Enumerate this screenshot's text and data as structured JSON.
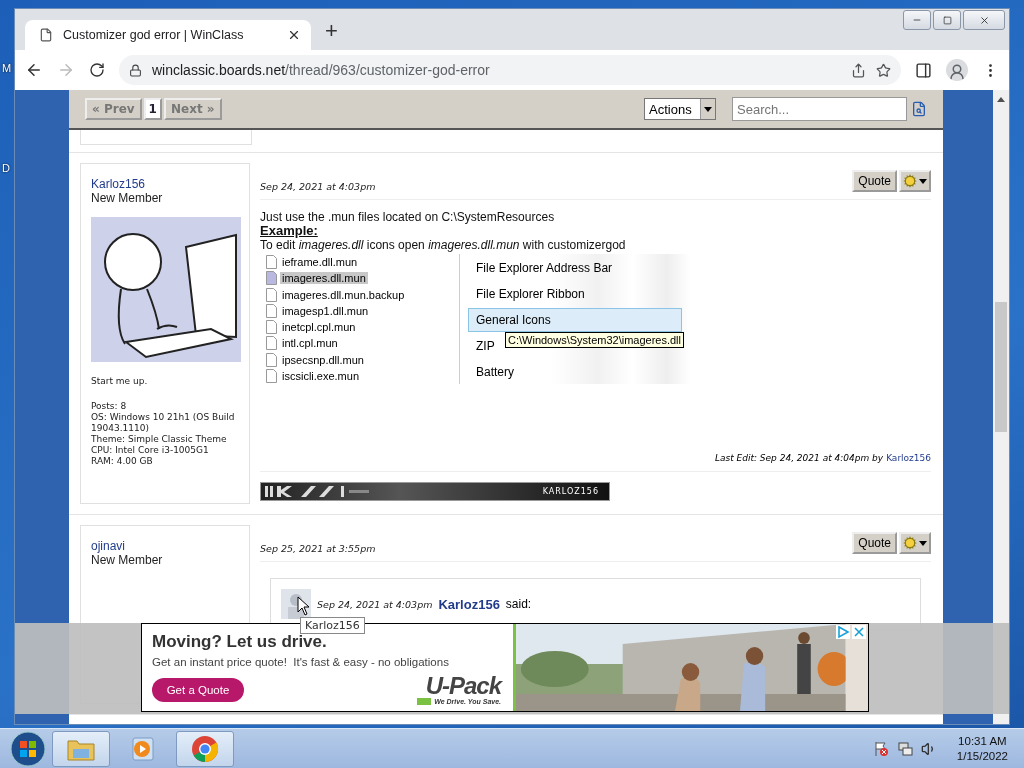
{
  "desktop": {
    "icon_labels": [
      "M",
      "D"
    ]
  },
  "browser": {
    "tab": {
      "title": "Customizer god error | WinClass",
      "selected": true
    },
    "new_tab": "+",
    "address": {
      "host": "winclassic.boards.net",
      "path": "/thread/963/customizer-god-error"
    }
  },
  "forum": {
    "pager": {
      "prev": "« Prev",
      "pages": [
        {
          "label": "1",
          "selected": true
        }
      ],
      "next": "Next »"
    },
    "actions": "Actions",
    "search": {
      "placeholder": "Search..."
    },
    "posts": [
      {
        "author": "Karloz156",
        "rank": "New Member",
        "personal_text": "Start me up.",
        "stats": [
          "Posts: 8",
          "OS: Windows 10 21h1 (OS Build 19043.1110)",
          "Theme: Simple Classic Theme",
          "CPU: Intel Core i3-1005G1",
          "RAM: 4.00 GB"
        ],
        "date": "Sep 24, 2021 at 4:03pm",
        "quote_button": "Quote",
        "body": [
          {
            "kind": "text",
            "text": "Just use the .mun files located on C:\\SystemResources"
          },
          {
            "kind": "heading",
            "text": "Example:"
          },
          {
            "kind": "text",
            "text": "To edit *imageres.dll* icons open *imageres.dll.mun* with customizergod"
          }
        ],
        "screenshot": {
          "files": [
            {
              "name": "ieframe.dll.mun",
              "selected": false
            },
            {
              "name": "imageres.dll.mun",
              "selected": true
            },
            {
              "name": "imageres.dll.mun.backup",
              "selected": false
            },
            {
              "name": "imagesp1.dll.mun",
              "selected": false
            },
            {
              "name": "inetcpl.cpl.mun",
              "selected": false
            },
            {
              "name": "intl.cpl.mun",
              "selected": false
            },
            {
              "name": "ipsecsnp.dll.mun",
              "selected": false
            },
            {
              "name": "iscsicli.exe.mun",
              "selected": false
            }
          ],
          "categories": [
            {
              "name": "File Explorer Address Bar",
              "selected": false
            },
            {
              "name": "File Explorer Ribbon",
              "selected": false
            },
            {
              "name": "General Icons",
              "selected": true
            },
            {
              "name": "ZIP",
              "selected": false
            },
            {
              "name": "Battery",
              "selected": false
            }
          ],
          "tooltip": "C:\\Windows\\System32\\imageres.dll"
        },
        "last_edit": {
          "text": "Last Edit: Sep 24, 2021 at 4:04pm by",
          "user": "Karloz156"
        },
        "signature_banner": {
          "text": "KARLOZ156"
        }
      },
      {
        "author": "ojinavi",
        "rank": "New Member",
        "date": "Sep 25, 2021 at 3:55pm",
        "quote_button": "Quote",
        "quote": {
          "date": "Sep 24, 2021 at 4:03pm",
          "user": "Karloz156",
          "said": "said:"
        }
      }
    ],
    "hover_tooltip": "Karloz156"
  },
  "ad": {
    "headline": "Moving? Let us drive.",
    "subtext": "Get an instant price quote!  It's fast & easy - no obligations",
    "cta": "Get a Quote",
    "logo": "U-Pack",
    "tagline": "We Drive. You Save."
  },
  "taskbar": {
    "apps": [
      {
        "kind": "folder",
        "open": true
      },
      {
        "kind": "media",
        "open": false
      },
      {
        "kind": "browser",
        "open": true
      }
    ],
    "clock": {
      "time": "10:31 AM",
      "date": "1/15/2022"
    }
  }
}
